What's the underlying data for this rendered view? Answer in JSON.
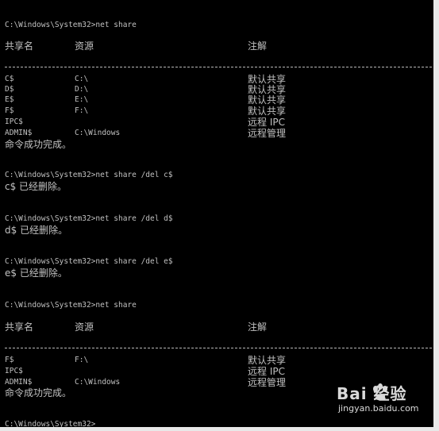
{
  "console": {
    "prompt": "C:\\Windows\\System32>",
    "cmd_share": "net share",
    "headers": {
      "name": "共享名",
      "resource": "资源",
      "remark": "注解"
    },
    "shares_before": [
      {
        "name": "C$",
        "resource": "C:\\",
        "remark": "默认共享"
      },
      {
        "name": "D$",
        "resource": "D:\\",
        "remark": "默认共享"
      },
      {
        "name": "E$",
        "resource": "E:\\",
        "remark": "默认共享"
      },
      {
        "name": "F$",
        "resource": "F:\\",
        "remark": "默认共享"
      },
      {
        "name": "IPC$",
        "resource": "",
        "remark": "远程 IPC"
      },
      {
        "name": "ADMIN$",
        "resource": "C:\\Windows",
        "remark": "远程管理"
      }
    ],
    "success": "命令成功完成。",
    "del_c": "C:\\Windows\\System32>net share /del c$",
    "del_c_result": "c$ 已经删除。",
    "del_d": "C:\\Windows\\System32>net share /del d$",
    "del_d_result": "d$ 已经删除。",
    "del_e": "C:\\Windows\\System32>net share /del e$",
    "del_e_result": "e$ 已经删除。",
    "shares_after": [
      {
        "name": "F$",
        "resource": "F:\\",
        "remark": "默认共享"
      },
      {
        "name": "IPC$",
        "resource": "",
        "remark": "远程 IPC"
      },
      {
        "name": "ADMIN$",
        "resource": "C:\\Windows",
        "remark": "远程管理"
      }
    ],
    "final_prompt": "C:\\Windows\\System32>"
  },
  "watermark": {
    "logo": "Bai  经验",
    "url": "jingyan.baidu.com"
  },
  "colors": {
    "background": "#000000",
    "text": "#c0c0c0"
  }
}
